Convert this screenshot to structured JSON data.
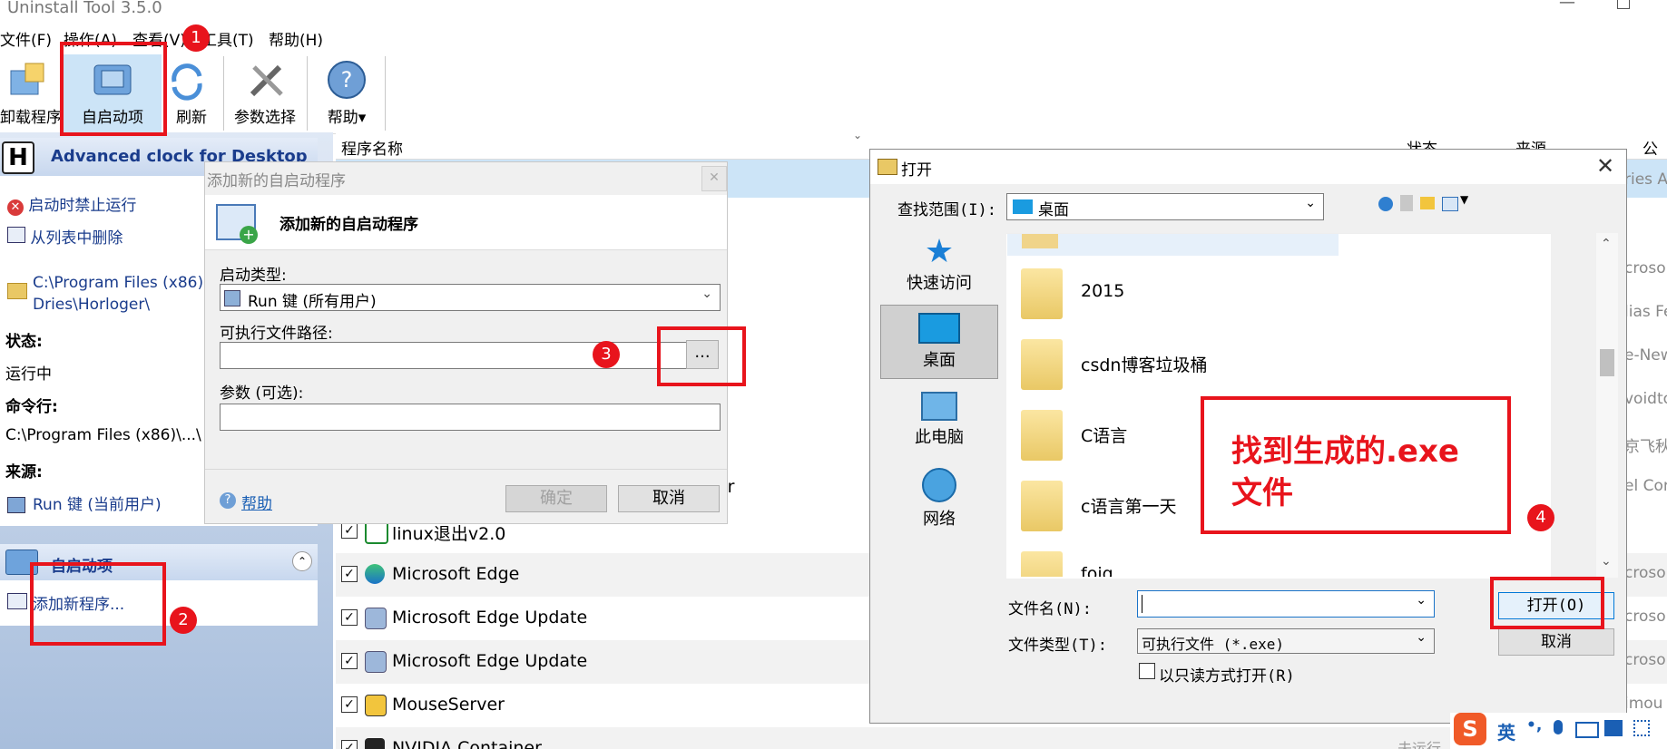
{
  "app": {
    "title": "Uninstall Tool 3.5.0"
  },
  "menu": [
    "文件(F)",
    "操作(A)",
    "查看(V)",
    "工具(T)",
    "帮助(H)"
  ],
  "toolbar": {
    "uninstall": "卸载程序",
    "autostart": "自启动项",
    "refresh": "刷新",
    "prefs": "参数选择",
    "help": "帮助"
  },
  "columns": {
    "name": "程序名称",
    "status": "状态",
    "source": "来源",
    "company": "公司"
  },
  "details": {
    "app_name": "Advanced clock for Desktop",
    "disable": "启动时禁止运行",
    "remove": "从列表中删除",
    "path_line1": "C:\\Program Files (x86)",
    "path_line2": "Dries\\Horloger\\",
    "status_label": "状态:",
    "status_value": "运行中",
    "cmd_label": "命令行:",
    "cmd_value": "C:\\Program Files (x86)\\...\\",
    "source_label": "来源:",
    "source_value": "Run 键 (当前用户)"
  },
  "autostart_panel": {
    "title": "自启动项",
    "add": "添加新程序..."
  },
  "list_rows": [
    {
      "name": "linux退出v2.0",
      "checked": "✓"
    },
    {
      "name": "Microsoft Edge",
      "checked": "✓"
    },
    {
      "name": "Microsoft Edge Update",
      "checked": "✓"
    },
    {
      "name": "Microsoft Edge Update",
      "checked": "✓"
    },
    {
      "name": "MouseServer",
      "checked": "✓"
    },
    {
      "name": "NVIDIA Container",
      "checked": "✓"
    }
  ],
  "list_extra": {
    "cut_name": "or",
    "last_status": "未运行"
  },
  "right_cut": [
    "ries A",
    "croso",
    "lias Fe",
    "e-New",
    "voidto",
    "京飞秋",
    "el Cor",
    "croso",
    "croso",
    "croso",
    "imou"
  ],
  "add_dialog": {
    "title": "添加新的自启动程序",
    "heading": "添加新的自启动程序",
    "type_label": "启动类型:",
    "type_value": "Run 键 (所有用户)",
    "path_label": "可执行文件路径:",
    "path_value": "",
    "browse": "...",
    "args_label": "参数 (可选):",
    "args_value": "",
    "help": "帮助",
    "ok": "确定",
    "cancel": "取消"
  },
  "open_dialog": {
    "title": "打开",
    "lookin_label": "查找范围(I):",
    "lookin_value": "桌面",
    "nav": [
      "快速访问",
      "桌面",
      "此电脑",
      "网络"
    ],
    "files": [
      "2015",
      "csdn博客垃圾桶",
      "C语言",
      "c语言第一天",
      "foiq"
    ],
    "filename_label": "文件名(N):",
    "filename_value": "",
    "filetype_label": "文件类型(T):",
    "filetype_value": "可执行文件 (*.exe)",
    "readonly": "以只读方式打开(R)",
    "open": "打开(O)",
    "cancel": "取消"
  },
  "annotation": {
    "text": "找到生成的.exe文件",
    "badges": [
      "1",
      "2",
      "3",
      "4"
    ]
  },
  "ime": {
    "lang": "英"
  },
  "colors": {
    "accent": "#e8141c",
    "selection": "#cce4f7",
    "header": "#1a3c8c"
  }
}
